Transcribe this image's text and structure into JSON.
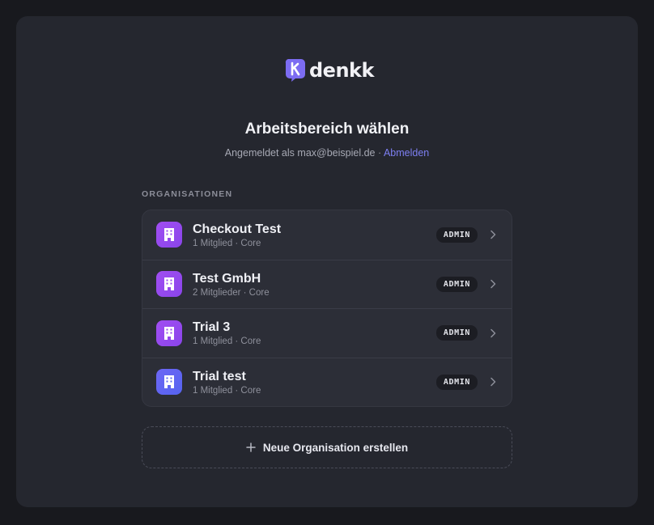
{
  "brand": {
    "name": "denkk",
    "accent": "#7c6cf2"
  },
  "header": {
    "title": "Arbeitsbereich wählen",
    "signed_in_prefix": "Angemeldet als",
    "email": "max@beispiel.de",
    "separator": "·",
    "logout_label": "Abmelden"
  },
  "organizations": {
    "section_label": "ORGANISATIONEN",
    "items": [
      {
        "name": "Checkout Test",
        "meta": "1 Mitglied · Core",
        "role": "ADMIN",
        "icon": "building-icon",
        "color": "#9b4df0"
      },
      {
        "name": "Test GmbH",
        "meta": "2 Mitglieder · Core",
        "role": "ADMIN",
        "icon": "building-icon",
        "color": "#9b4df0"
      },
      {
        "name": "Trial 3",
        "meta": "1 Mitglied · Core",
        "role": "ADMIN",
        "icon": "building-icon",
        "color": "#9b4df0"
      },
      {
        "name": "Trial test",
        "meta": "1 Mitglied · Core",
        "role": "ADMIN",
        "icon": "building-icon",
        "color": "#6168f3"
      }
    ]
  },
  "create": {
    "label": "Neue Organisation erstellen",
    "icon": "plus-icon"
  }
}
